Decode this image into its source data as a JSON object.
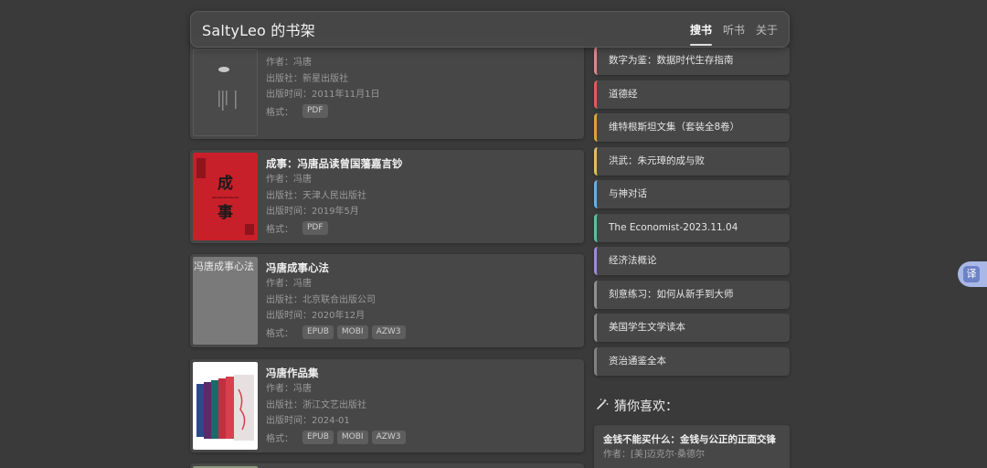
{
  "header": {
    "title": "SaltyLeo 的书架",
    "nav": [
      "搜书",
      "听书",
      "关于"
    ]
  },
  "books": [
    {
      "title": "",
      "author": "作者：冯唐",
      "publisher": "出版社：新星出版社",
      "date": "出版时间：2011年11月1日",
      "formats_label": "格式：",
      "formats": [
        "PDF"
      ]
    },
    {
      "title": "成事：冯唐品读曾国藩嘉言钞",
      "author": "作者：冯唐",
      "publisher": "出版社：天津人民出版社",
      "date": "出版时间：2019年5月",
      "formats_label": "格式：",
      "formats": [
        "PDF"
      ],
      "cover_text": [
        "成",
        "事"
      ]
    },
    {
      "title": "冯唐成事心法",
      "author": "作者：冯唐",
      "publisher": "出版社：北京联合出版公司",
      "date": "出版时间：2020年12月",
      "formats_label": "格式：",
      "formats": [
        "EPUB",
        "MOBI",
        "AZW3"
      ],
      "cover_alt": "冯唐成事心法"
    },
    {
      "title": "冯唐作品集",
      "author": "作者：冯唐",
      "publisher": "出版社：浙江文艺出版社",
      "date": "出版时间：2024-01",
      "formats_label": "格式：",
      "formats": [
        "EPUB",
        "MOBI",
        "AZW3"
      ]
    }
  ],
  "rank_list": [
    {
      "label": "数字为鉴：数据时代生存指南",
      "color": "#d98a8a"
    },
    {
      "label": "道德经",
      "color": "#e05a5a"
    },
    {
      "label": "维特根斯坦文集（套装全8卷）",
      "color": "#e0a040"
    },
    {
      "label": "洪武：朱元璋的成与败",
      "color": "#e0c060"
    },
    {
      "label": "与神对话",
      "color": "#6aaee0"
    },
    {
      "label": "The Economist-2023.11.04",
      "color": "#5ac0a0"
    },
    {
      "label": "经济法概论",
      "color": "#a08ad0"
    },
    {
      "label": "刻意练习：如何从新手到大师",
      "color": "#909090"
    },
    {
      "label": "美国学生文学读本",
      "color": "#8a8a8a"
    },
    {
      "label": "资治通鉴全本",
      "color": "#808080"
    }
  ],
  "recommend": {
    "title": "猜你喜欢：",
    "items": [
      {
        "title": "金钱不能买什么：金钱与公正的正面交锋",
        "author": "作者：[美]迈克尔·桑德尔"
      }
    ]
  },
  "translate_button": "译"
}
